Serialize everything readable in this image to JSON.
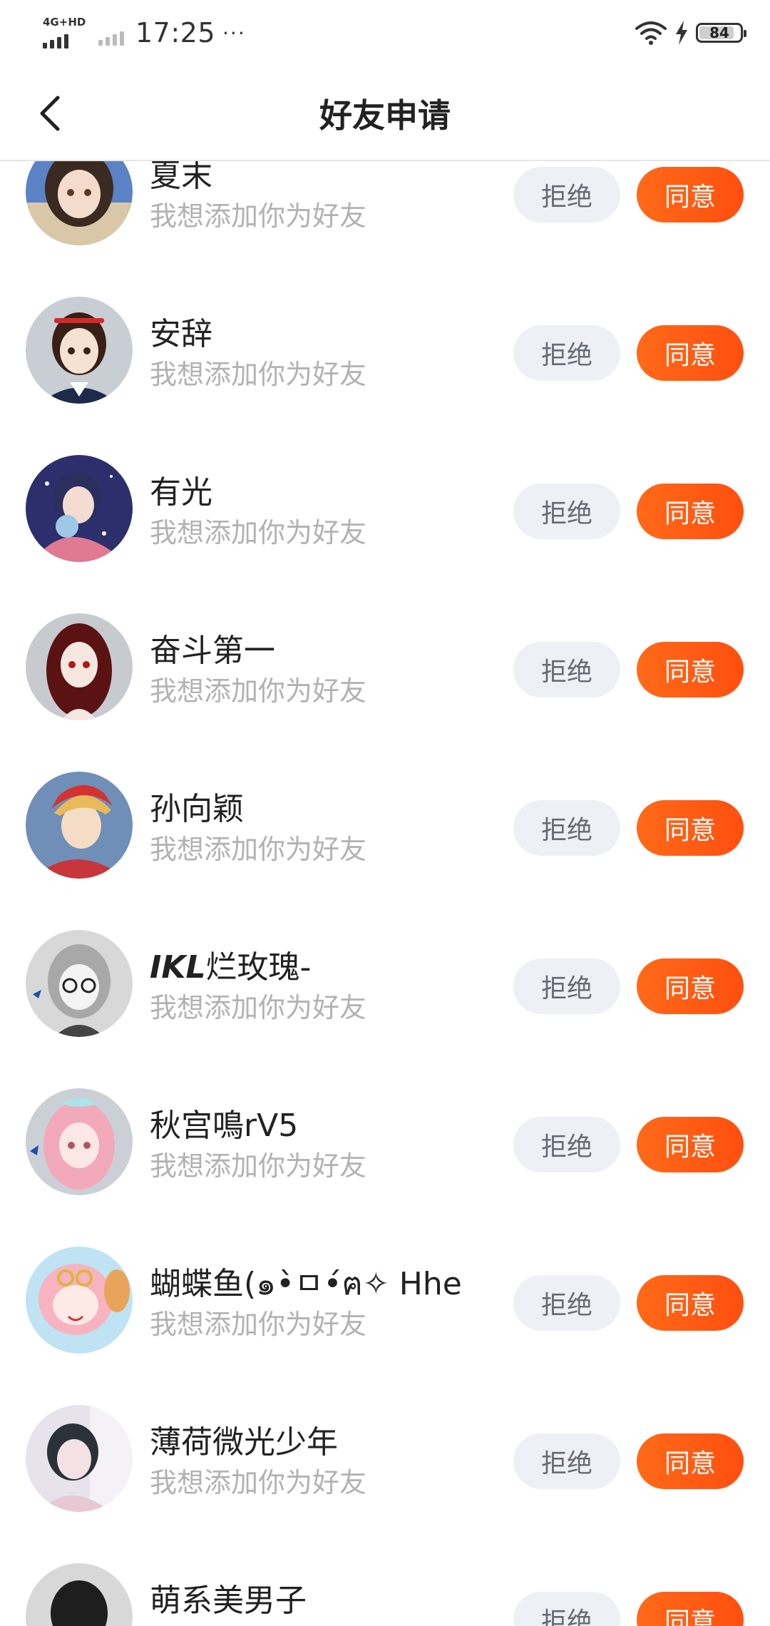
{
  "status_bar": {
    "network": "4G+HD",
    "time": "17:25",
    "more": "···",
    "battery": "84"
  },
  "header": {
    "title": "好友申请"
  },
  "requests": [
    {
      "name": "夏末",
      "message": "我想添加你为好友",
      "reject_label": "拒绝",
      "agree_label": "同意"
    },
    {
      "name": "安辞",
      "message": "我想添加你为好友",
      "reject_label": "拒绝",
      "agree_label": "同意"
    },
    {
      "name": "有光",
      "message": "我想添加你为好友",
      "reject_label": "拒绝",
      "agree_label": "同意"
    },
    {
      "name": "奋斗第一",
      "message": "我想添加你为好友",
      "reject_label": "拒绝",
      "agree_label": "同意"
    },
    {
      "name": "孙向颖",
      "message": "我想添加你为好友",
      "reject_label": "拒绝",
      "agree_label": "同意"
    },
    {
      "name_prefix": "IKL",
      "name": "烂玫瑰-",
      "message": "我想添加你为好友",
      "reject_label": "拒绝",
      "agree_label": "同意"
    },
    {
      "name": "秋宫鳴rV5",
      "message": "我想添加你为好友",
      "reject_label": "拒绝",
      "agree_label": "同意"
    },
    {
      "name": "蝴蝶鱼(๑•̀ㅁ•́ฅ✧ Hhe",
      "message": "我想添加你为好友",
      "reject_label": "拒绝",
      "agree_label": "同意"
    },
    {
      "name": "薄荷微光少年",
      "message": "我想添加你为好友",
      "reject_label": "拒绝",
      "agree_label": "同意"
    },
    {
      "name": "萌系美男子",
      "message": "",
      "reject_label": "拒绝",
      "agree_label": "同意"
    }
  ],
  "icons": {
    "back": "chevron-left-icon",
    "wifi": "wifi-icon",
    "charging": "lightning-icon",
    "battery": "battery-icon"
  },
  "colors": {
    "agree": "#ff5a16",
    "reject_bg": "#eef0f5",
    "message": "#b2b2b2"
  }
}
